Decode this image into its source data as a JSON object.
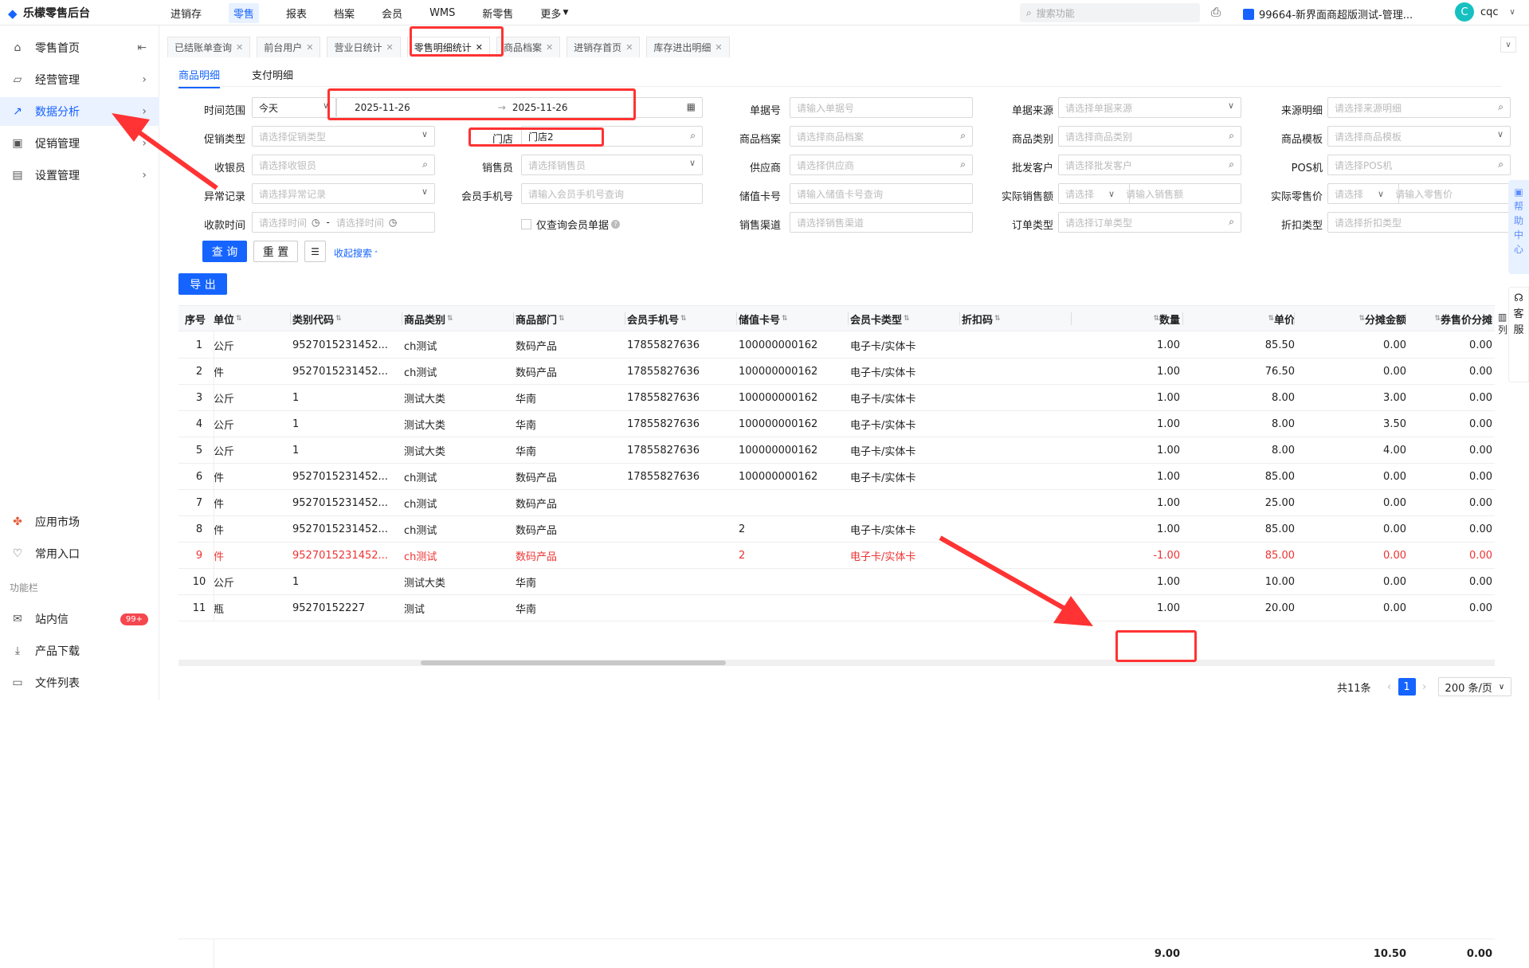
{
  "app": {
    "logo": "乐檬零售后台"
  },
  "topnav": [
    "进销存",
    "零售",
    "报表",
    "档案",
    "会员",
    "WMS",
    "新零售",
    "更多"
  ],
  "search": {
    "placeholder": "搜索功能"
  },
  "store": "99664-新界面商超版测试-管理...",
  "user": {
    "avatar": "C",
    "name": "cqc"
  },
  "sidebar": {
    "items": [
      "零售首页",
      "经营管理",
      "数据分析",
      "促销管理",
      "设置管理"
    ],
    "bottom_items": [
      "应用市场",
      "常用入口"
    ],
    "section_label": "功能栏",
    "func_items": [
      "站内信",
      "产品下载",
      "文件列表"
    ],
    "badge": "99+"
  },
  "tabs": [
    "已结账单查询",
    "前台用户",
    "营业日统计",
    "零售明细统计",
    "商品档案",
    "进销存首页",
    "库存进出明细"
  ],
  "subtabs": [
    "商品明细",
    "支付明细"
  ],
  "form": {
    "time_range_label": "时间范围",
    "time_range_value": "今天",
    "date_from": "2025-11-26",
    "date_to": "2025-11-26",
    "date_arrow": "→",
    "bill_no_label": "单据号",
    "bill_no_ph": "请输入单据号",
    "bill_src_label": "单据来源",
    "bill_src_ph": "请选择单据来源",
    "src_detail_label": "来源明细",
    "src_detail_ph": "请选择来源明细",
    "promo_label": "促销类型",
    "promo_ph": "请选择促销类型",
    "store_label": "门店",
    "store_value": "门店2",
    "goods_label": "商品档案",
    "goods_ph": "请选择商品档案",
    "category_label": "商品类别",
    "category_ph": "请选择商品类别",
    "template_label": "商品模板",
    "template_ph": "请选择商品模板",
    "cashier_label": "收银员",
    "cashier_ph": "请选择收银员",
    "sales_label": "销售员",
    "sales_ph": "请选择销售员",
    "supplier_label": "供应商",
    "supplier_ph": "请选择供应商",
    "wholesale_label": "批发客户",
    "wholesale_ph": "请选择批发客户",
    "pos_label": "POS机",
    "pos_ph": "请选择POS机",
    "abnormal_label": "异常记录",
    "abnormal_ph": "请选择异常记录",
    "member_phone_label": "会员手机号",
    "member_phone_ph": "请输入会员手机号查询",
    "stored_card_label": "储值卡号",
    "stored_card_ph": "请输入储值卡号查询",
    "actual_sales_label": "实际销售额",
    "actual_sales_sel_ph": "请选择",
    "actual_sales_ph": "请输入销售额",
    "actual_price_label": "实际零售价",
    "actual_price_sel_ph": "请选择",
    "actual_price_ph": "请输入零售价",
    "pay_time_label": "收款时间",
    "pay_time_from_ph": "请选择时间",
    "pay_time_to_ph": "请选择时间",
    "pay_time_dash": "-",
    "member_only_label": "仅查询会员单据",
    "channel_label": "销售渠道",
    "channel_ph": "请选择销售渠道",
    "order_type_label": "订单类型",
    "order_type_ph": "请选择订单类型",
    "discount_type_label": "折扣类型",
    "discount_type_ph": "请选择折扣类型",
    "query_btn": "查 询",
    "reset_btn": "重 置",
    "collapse_link": "收起搜索",
    "export_btn": "导 出"
  },
  "table": {
    "headers": [
      "序号",
      "单位",
      "类别代码",
      "商品类别",
      "商品部门",
      "会员手机号",
      "储值卡号",
      "会员卡类型",
      "折扣码",
      "数量",
      "单价",
      "分摊金额",
      "券售价分摊"
    ],
    "rows": [
      [
        "1",
        "公斤",
        "9527015231452...",
        "ch测试",
        "数码产品",
        "17855827636",
        "100000000162",
        "电子卡/实体卡",
        "",
        "1.00",
        "85.50",
        "0.00",
        "0.00"
      ],
      [
        "2",
        "件",
        "9527015231452...",
        "ch测试",
        "数码产品",
        "17855827636",
        "100000000162",
        "电子卡/实体卡",
        "",
        "1.00",
        "76.50",
        "0.00",
        "0.00"
      ],
      [
        "3",
        "公斤",
        "1",
        "测试大类",
        "华南",
        "17855827636",
        "100000000162",
        "电子卡/实体卡",
        "",
        "1.00",
        "8.00",
        "3.00",
        "0.00"
      ],
      [
        "4",
        "公斤",
        "1",
        "测试大类",
        "华南",
        "17855827636",
        "100000000162",
        "电子卡/实体卡",
        "",
        "1.00",
        "8.00",
        "3.50",
        "0.00"
      ],
      [
        "5",
        "公斤",
        "1",
        "测试大类",
        "华南",
        "17855827636",
        "100000000162",
        "电子卡/实体卡",
        "",
        "1.00",
        "8.00",
        "4.00",
        "0.00"
      ],
      [
        "6",
        "件",
        "9527015231452...",
        "ch测试",
        "数码产品",
        "17855827636",
        "100000000162",
        "电子卡/实体卡",
        "",
        "1.00",
        "85.00",
        "0.00",
        "0.00"
      ],
      [
        "7",
        "件",
        "9527015231452...",
        "ch测试",
        "数码产品",
        "",
        "",
        "",
        "",
        "1.00",
        "25.00",
        "0.00",
        "0.00"
      ],
      [
        "8",
        "件",
        "9527015231452...",
        "ch测试",
        "数码产品",
        "",
        "2",
        "电子卡/实体卡",
        "",
        "1.00",
        "85.00",
        "0.00",
        "0.00"
      ],
      [
        "9",
        "件",
        "9527015231452...",
        "ch测试",
        "数码产品",
        "",
        "2",
        "电子卡/实体卡",
        "",
        "-1.00",
        "85.00",
        "0.00",
        "0.00"
      ],
      [
        "10",
        "公斤",
        "1",
        "测试大类",
        "华南",
        "",
        "",
        "",
        "",
        "1.00",
        "10.00",
        "0.00",
        "0.00"
      ],
      [
        "11",
        "瓶",
        "95270152227",
        "测试",
        "华南",
        "",
        "",
        "",
        "",
        "1.00",
        "20.00",
        "0.00",
        "0.00"
      ]
    ],
    "red_row_index": 8,
    "summary": {
      "qty": "9.00",
      "alloc": "10.50",
      "coupon": "0.00"
    },
    "col_setting": "列"
  },
  "pager": {
    "total": "共11条",
    "current": "1",
    "page_size": "200 条/页"
  },
  "float": {
    "help": [
      "帮",
      "助",
      "中",
      "心"
    ],
    "service": [
      "客",
      "服"
    ]
  },
  "colors": {
    "accent": "#1664ff",
    "highlight": "#ff3333"
  }
}
